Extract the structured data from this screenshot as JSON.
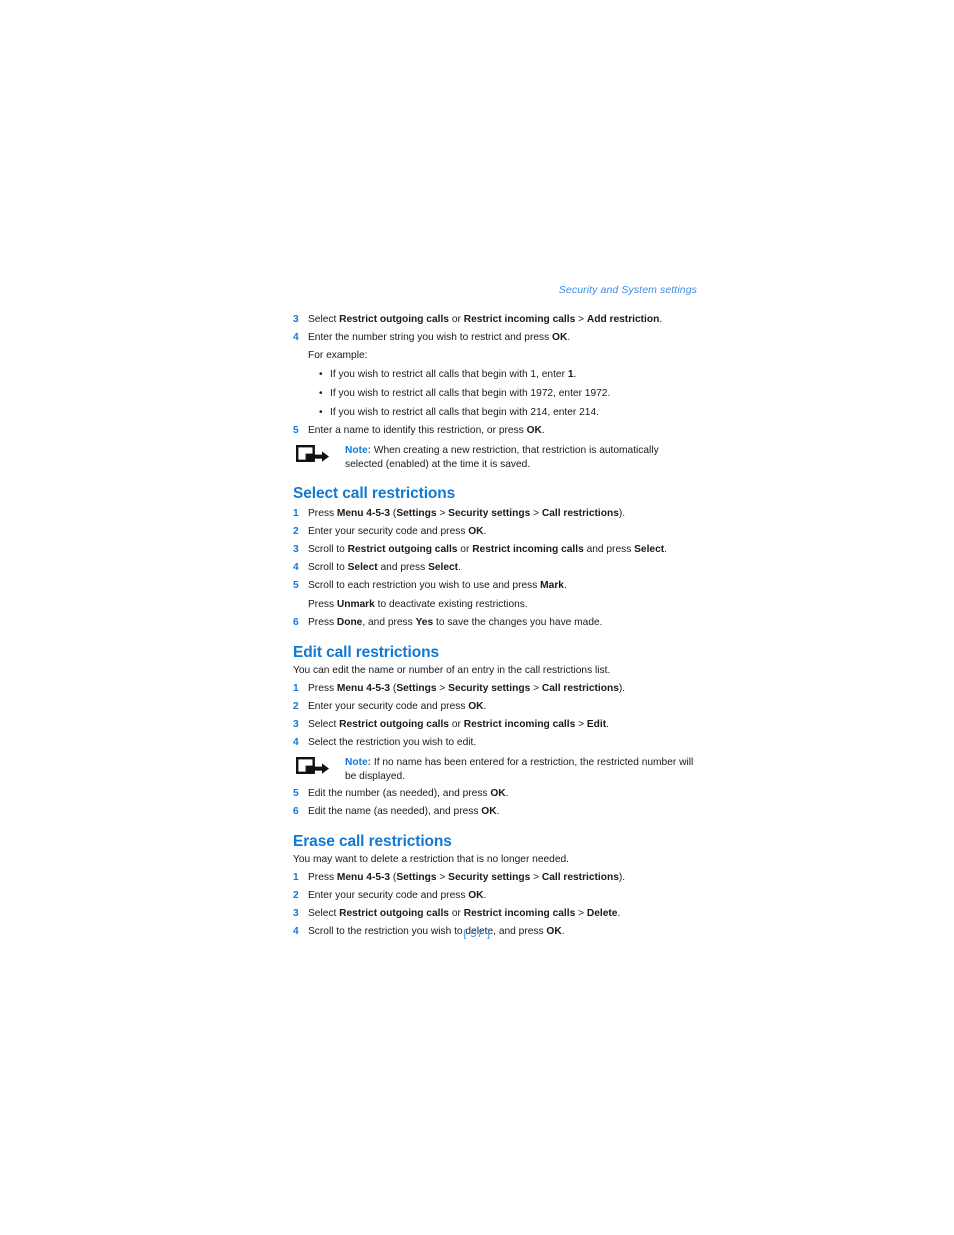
{
  "header": {
    "running_title": "Security and System settings"
  },
  "folio": {
    "page_number": "[ 57 ]"
  },
  "colors": {
    "heading_blue": "#1278d4",
    "header_blue": "#3b8ceb",
    "body_black": "#1a1a1a"
  },
  "continued_steps": [
    {
      "num": "3",
      "parts": [
        {
          "t": "Select ",
          "b": false
        },
        {
          "t": "Restrict outgoing calls",
          "b": true
        },
        {
          "t": " or ",
          "b": false
        },
        {
          "t": "Restrict incoming calls",
          "b": true
        },
        {
          "t": " > ",
          "b": false
        },
        {
          "t": "Add restriction",
          "b": true
        },
        {
          "t": ".",
          "b": false
        }
      ]
    },
    {
      "num": "4",
      "parts": [
        {
          "t": "Enter the number string you wish to restrict and press ",
          "b": false
        },
        {
          "t": "OK",
          "b": true
        },
        {
          "t": ".",
          "b": false
        }
      ]
    }
  ],
  "for_example_label": "For example:",
  "examples": [
    [
      {
        "t": "If you wish to restrict all calls that begin with 1, enter ",
        "b": false
      },
      {
        "t": "1",
        "b": true
      },
      {
        "t": ".",
        "b": false
      }
    ],
    [
      {
        "t": "If you wish to restrict all calls that begin with 1972, enter 1972.",
        "b": false
      }
    ],
    [
      {
        "t": "If you wish to restrict all calls that begin with 214, enter 214.",
        "b": false
      }
    ]
  ],
  "step_five": {
    "num": "5",
    "parts": [
      {
        "t": "Enter a name to identify this restriction, or press ",
        "b": false
      },
      {
        "t": "OK",
        "b": true
      },
      {
        "t": ".",
        "b": false
      }
    ]
  },
  "note_one": {
    "label": "Note:",
    "text": " When creating a new restriction, that restriction is automatically selected (enabled) at the time it is saved.",
    "icon": "note-arrow-icon"
  },
  "sections": [
    {
      "id": "select-call-restrictions",
      "heading": "Select call restrictions",
      "intro": null,
      "steps": [
        {
          "num": "1",
          "parts": [
            {
              "t": "Press ",
              "b": false
            },
            {
              "t": "Menu 4-5-3",
              "b": true
            },
            {
              "t": " (",
              "b": false
            },
            {
              "t": "Settings",
              "b": true
            },
            {
              "t": " > ",
              "b": false
            },
            {
              "t": "Security settings",
              "b": true
            },
            {
              "t": " > ",
              "b": false
            },
            {
              "t": "Call restrictions",
              "b": true
            },
            {
              "t": ").",
              "b": false
            }
          ]
        },
        {
          "num": "2",
          "parts": [
            {
              "t": "Enter your security code and press ",
              "b": false
            },
            {
              "t": "OK",
              "b": true
            },
            {
              "t": ".",
              "b": false
            }
          ]
        },
        {
          "num": "3",
          "parts": [
            {
              "t": "Scroll to ",
              "b": false
            },
            {
              "t": "Restrict outgoing calls",
              "b": true
            },
            {
              "t": " or ",
              "b": false
            },
            {
              "t": "Restrict incoming calls",
              "b": true
            },
            {
              "t": " and press ",
              "b": false
            },
            {
              "t": "Select",
              "b": true
            },
            {
              "t": ".",
              "b": false
            }
          ]
        },
        {
          "num": "4",
          "parts": [
            {
              "t": "Scroll to ",
              "b": false
            },
            {
              "t": "Select",
              "b": true
            },
            {
              "t": " and press ",
              "b": false
            },
            {
              "t": "Select",
              "b": true
            },
            {
              "t": ".",
              "b": false
            }
          ]
        },
        {
          "num": "5",
          "parts": [
            {
              "t": "Scroll to each restriction you wish to use and press ",
              "b": false
            },
            {
              "t": "Mark",
              "b": true
            },
            {
              "t": ".",
              "b": false
            }
          ]
        }
      ],
      "sub_line": [
        {
          "t": "Press ",
          "b": false
        },
        {
          "t": "Unmark",
          "b": true
        },
        {
          "t": " to deactivate existing restrictions.",
          "b": false
        }
      ],
      "final_step": {
        "num": "6",
        "parts": [
          {
            "t": "Press ",
            "b": false
          },
          {
            "t": "Done",
            "b": true
          },
          {
            "t": ", and press ",
            "b": false
          },
          {
            "t": "Yes",
            "b": true
          },
          {
            "t": " to save the changes you have made.",
            "b": false
          }
        ]
      }
    }
  ],
  "edit_section": {
    "heading": "Edit call restrictions",
    "intro": "You can edit the name or number of an entry in the call restrictions list.",
    "steps_before_note": [
      {
        "num": "1",
        "parts": [
          {
            "t": "Press ",
            "b": false
          },
          {
            "t": "Menu 4-5-3",
            "b": true
          },
          {
            "t": " (",
            "b": false
          },
          {
            "t": "Settings",
            "b": true
          },
          {
            "t": " > ",
            "b": false
          },
          {
            "t": "Security settings",
            "b": true
          },
          {
            "t": " > ",
            "b": false
          },
          {
            "t": "Call restrictions",
            "b": true
          },
          {
            "t": ").",
            "b": false
          }
        ]
      },
      {
        "num": "2",
        "parts": [
          {
            "t": "Enter your security code and press ",
            "b": false
          },
          {
            "t": "OK",
            "b": true
          },
          {
            "t": ".",
            "b": false
          }
        ]
      },
      {
        "num": "3",
        "parts": [
          {
            "t": "Select ",
            "b": false
          },
          {
            "t": "Restrict outgoing calls",
            "b": true
          },
          {
            "t": " or ",
            "b": false
          },
          {
            "t": "Restrict incoming calls",
            "b": true
          },
          {
            "t": " > ",
            "b": false
          },
          {
            "t": "Edit",
            "b": true
          },
          {
            "t": ".",
            "b": false
          }
        ]
      },
      {
        "num": "4",
        "parts": [
          {
            "t": "Select the restriction you wish to edit.",
            "b": false
          }
        ]
      }
    ],
    "note": {
      "label": "Note:",
      "text": " If no name has been entered for a restriction, the restricted number will be displayed.",
      "icon": "note-arrow-icon"
    },
    "steps_after_note": [
      {
        "num": "5",
        "parts": [
          {
            "t": "Edit the number (as needed), and press ",
            "b": false
          },
          {
            "t": "OK",
            "b": true
          },
          {
            "t": ".",
            "b": false
          }
        ]
      },
      {
        "num": "6",
        "parts": [
          {
            "t": "Edit the name (as needed), and press ",
            "b": false
          },
          {
            "t": "OK",
            "b": true
          },
          {
            "t": ".",
            "b": false
          }
        ]
      }
    ]
  },
  "erase_section": {
    "heading": "Erase call restrictions",
    "intro": "You may want to delete a restriction that is no longer needed.",
    "steps": [
      {
        "num": "1",
        "parts": [
          {
            "t": "Press ",
            "b": false
          },
          {
            "t": "Menu 4-5-3",
            "b": true
          },
          {
            "t": " (",
            "b": false
          },
          {
            "t": "Settings",
            "b": true
          },
          {
            "t": " > ",
            "b": false
          },
          {
            "t": "Security settings",
            "b": true
          },
          {
            "t": " > ",
            "b": false
          },
          {
            "t": "Call restrictions",
            "b": true
          },
          {
            "t": ").",
            "b": false
          }
        ]
      },
      {
        "num": "2",
        "parts": [
          {
            "t": "Enter your security code and press ",
            "b": false
          },
          {
            "t": "OK",
            "b": true
          },
          {
            "t": ".",
            "b": false
          }
        ]
      },
      {
        "num": "3",
        "parts": [
          {
            "t": "Select ",
            "b": false
          },
          {
            "t": "Restrict outgoing calls",
            "b": true
          },
          {
            "t": " or ",
            "b": false
          },
          {
            "t": "Restrict incoming calls",
            "b": true
          },
          {
            "t": " > ",
            "b": false
          },
          {
            "t": "Delete",
            "b": true
          },
          {
            "t": ".",
            "b": false
          }
        ]
      },
      {
        "num": "4",
        "parts": [
          {
            "t": "Scroll to the restriction you wish to delete, and press ",
            "b": false
          },
          {
            "t": "OK",
            "b": true
          },
          {
            "t": ".",
            "b": false
          }
        ]
      }
    ]
  }
}
